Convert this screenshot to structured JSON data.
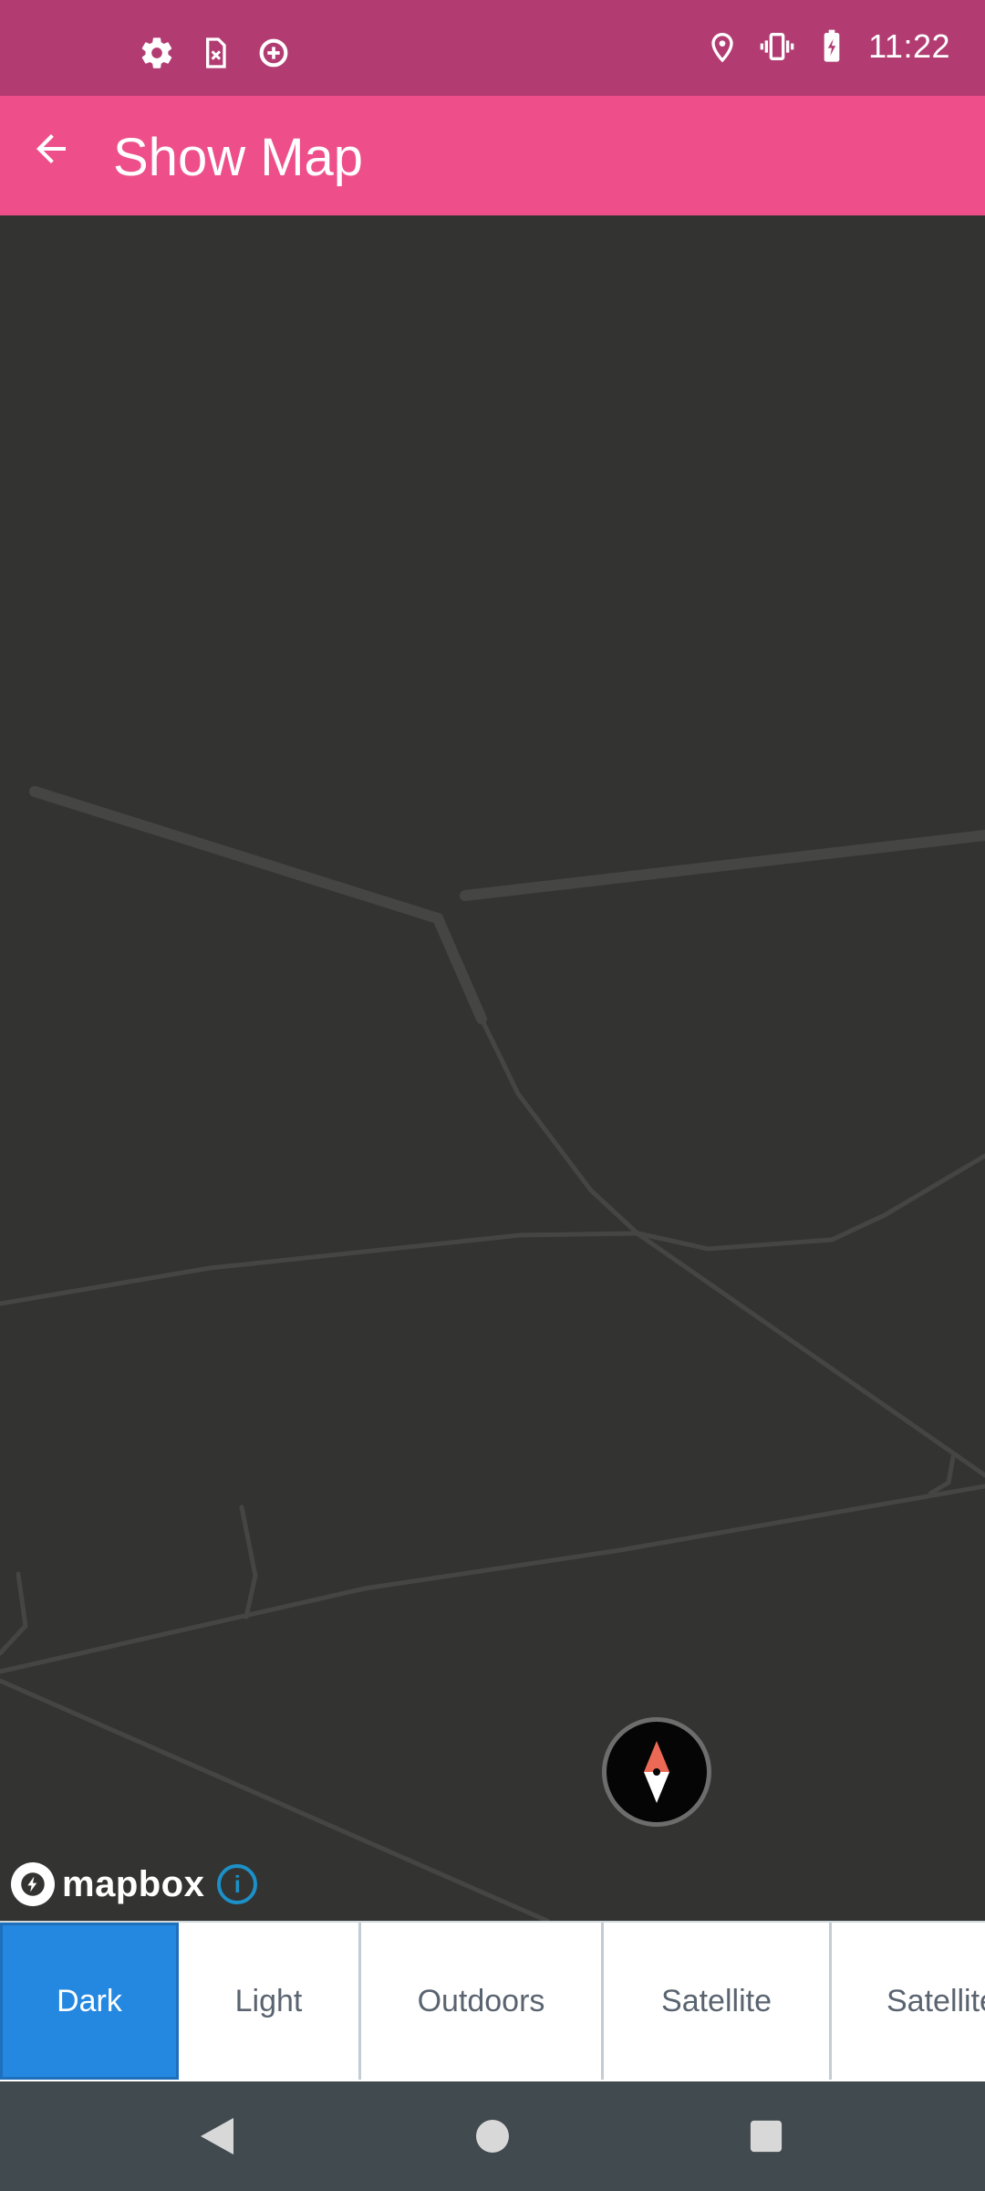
{
  "status_bar": {
    "time": "11:22",
    "left_icons": [
      "settings-icon",
      "sim-card-x-icon",
      "data-saver-icon"
    ],
    "right_icons": [
      "location-icon",
      "vibrate-icon",
      "battery-charging-icon"
    ]
  },
  "app_bar": {
    "title": "Show Map",
    "back_icon": "arrow-back-icon"
  },
  "map": {
    "theme_color": "#333331",
    "road_color": "#454543",
    "attribution": {
      "logo_text": "mapbox",
      "info_label": "i"
    },
    "compass_icon": "compass-icon"
  },
  "style_tabs": {
    "items": [
      {
        "label": "Dark",
        "active": true
      },
      {
        "label": "Light",
        "active": false
      },
      {
        "label": "Outdoors",
        "active": false
      },
      {
        "label": "Satellite",
        "active": false
      },
      {
        "label": "Satellite",
        "active": false
      }
    ],
    "active_color": "#2488e0"
  },
  "nav_bar": {
    "buttons": [
      "back-triangle-icon",
      "home-circle-icon",
      "recents-square-icon"
    ]
  }
}
